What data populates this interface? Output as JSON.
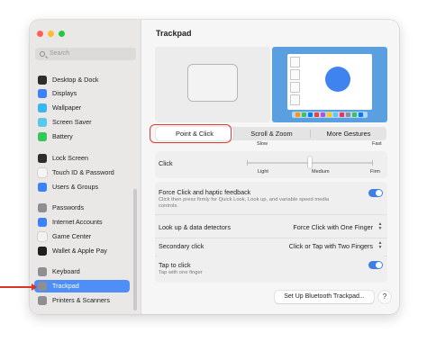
{
  "window": {
    "traffic_lights": [
      {
        "name": "close",
        "color": "#ff5f57"
      },
      {
        "name": "minimize",
        "color": "#febc2e"
      },
      {
        "name": "zoom",
        "color": "#28c840"
      }
    ]
  },
  "sidebar": {
    "search_placeholder": "Search",
    "items": [
      {
        "label": "Desktop & Dock",
        "icon": "desktop-dock-icon",
        "color": "#2d2d2d"
      },
      {
        "label": "Displays",
        "icon": "displays-icon",
        "color": "#3b82f6"
      },
      {
        "label": "Wallpaper",
        "icon": "wallpaper-icon",
        "color": "#38b6f2"
      },
      {
        "label": "Screen Saver",
        "icon": "screen-saver-icon",
        "color": "#5ac8e8"
      },
      {
        "label": "Battery",
        "icon": "battery-icon",
        "color": "#34c759"
      },
      {
        "label": "Lock Screen",
        "icon": "lock-screen-icon",
        "color": "#2d2d2d"
      },
      {
        "label": "Touch ID & Password",
        "icon": "touch-id-icon",
        "color": "#f5f5f5"
      },
      {
        "label": "Users & Groups",
        "icon": "users-groups-icon",
        "color": "#3b82f6"
      },
      {
        "label": "Passwords",
        "icon": "passwords-icon",
        "color": "#8e8e93"
      },
      {
        "label": "Internet Accounts",
        "icon": "internet-accounts-icon",
        "color": "#3b82f6"
      },
      {
        "label": "Game Center",
        "icon": "game-center-icon",
        "color": "#f2f2f2"
      },
      {
        "label": "Wallet & Apple Pay",
        "icon": "wallet-icon",
        "color": "#1f1f1f"
      },
      {
        "label": "Keyboard",
        "icon": "keyboard-icon",
        "color": "#8e8e93"
      },
      {
        "label": "Trackpad",
        "icon": "trackpad-icon",
        "color": "#8e8e93",
        "selected": true
      },
      {
        "label": "Printers & Scanners",
        "icon": "printers-icon",
        "color": "#8e8e93"
      }
    ]
  },
  "main": {
    "title": "Trackpad",
    "tabs": [
      {
        "label": "Point & Click",
        "active": true
      },
      {
        "label": "Scroll & Zoom",
        "active": false
      },
      {
        "label": "More Gestures",
        "active": false
      }
    ],
    "tracking": {
      "slow_label": "Slow",
      "fast_label": "Fast"
    },
    "click": {
      "label": "Click",
      "light_label": "Light",
      "medium_label": "Medium",
      "firm_label": "Firm",
      "level": 0.5
    },
    "force_click": {
      "label": "Force Click and haptic feedback",
      "description": "Click then press firmly for Quick Look, Look up, and variable speed media controls.",
      "on": true
    },
    "lookup": {
      "label": "Look up & data detectors",
      "value": "Force Click with One Finger"
    },
    "secondary": {
      "label": "Secondary click",
      "value": "Click or Tap with Two Fingers"
    },
    "tap_to_click": {
      "label": "Tap to click",
      "description": "Tap with one finger",
      "on": true
    },
    "bluetooth_button": "Set Up Bluetooth Trackpad...",
    "help_button": "?"
  },
  "colors": {
    "accent": "#3d7fe8",
    "highlight": "#e03a2f"
  }
}
